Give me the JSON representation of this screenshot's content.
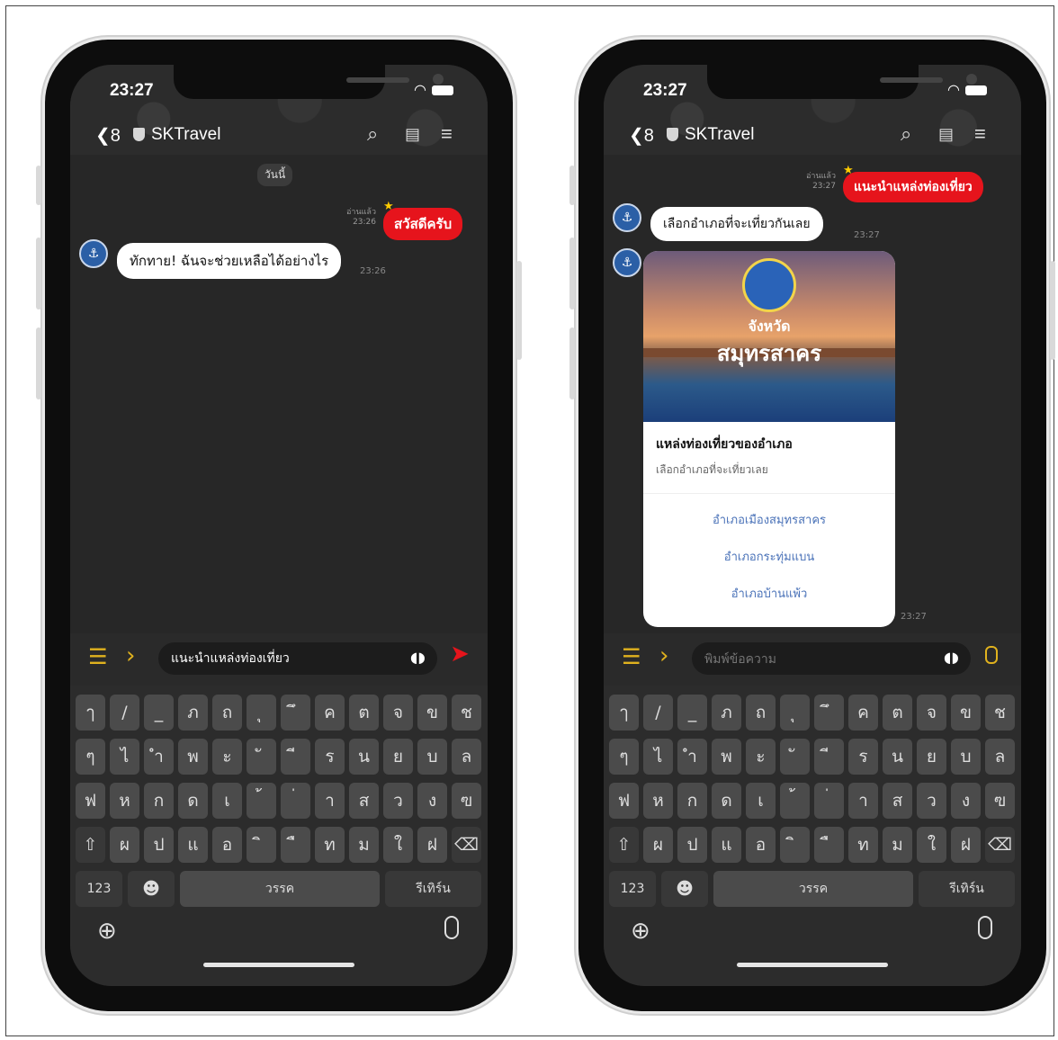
{
  "status_time": "23:27",
  "chat": {
    "back_count": "8",
    "name": "SKTravel"
  },
  "left": {
    "day_label": "วันนี้",
    "read_label": "อ่านแล้ว",
    "out_time": "23:26",
    "out_text": "สวัสดีครับ",
    "in_text": "ทักทาย! ฉันจะช่วยเหลือได้อย่างไร",
    "in_time": "23:26",
    "input_value": "แนะนำแหล่งท่องเที่ยว"
  },
  "right": {
    "read_label": "อ่านแล้ว",
    "out_time": "23:27",
    "out_text": "แนะนำแหล่งท่องเที่ยว",
    "in_text": "เลือกอำเภอที่จะเที่ยวกันเลย",
    "in_time": "23:27",
    "card": {
      "image_line1": "จังหวัด",
      "image_line2": "สมุทรสาคร",
      "title": "แหล่งท่องเที่ยวของอำเภอ",
      "subtitle": "เลือกอำเภอที่จะเที่ยวเลย",
      "options": [
        "อำเภอเมืองสมุทรสาคร",
        "อำเภอกระทุ่มแบน",
        "อำเภอบ้านแพ้ว"
      ],
      "time": "23:27"
    },
    "input_placeholder": "พิมพ์ข้อความ"
  },
  "keyboard": {
    "row1": [
      "ๅ",
      "/",
      "_",
      "ภ",
      "ถ",
      "ุ",
      "ึ",
      "ค",
      "ต",
      "จ",
      "ข",
      "ช"
    ],
    "row2": [
      "ๆ",
      "ไ",
      "ำ",
      "พ",
      "ะ",
      "ั",
      "ี",
      "ร",
      "น",
      "ย",
      "บ",
      "ล"
    ],
    "row3": [
      "ฟ",
      "ห",
      "ก",
      "ด",
      "เ",
      "้",
      "่",
      "า",
      "ส",
      "ว",
      "ง",
      "ฃ"
    ],
    "row4": [
      "ผ",
      "ป",
      "แ",
      "อ",
      "ิ",
      "ื",
      "ท",
      "ม",
      "ใ",
      "ฝ"
    ],
    "shift": "⇧",
    "delete": "⌫",
    "numbers": "123",
    "emoji": "☻",
    "space": "วรรค",
    "return": "รีเทิร์น"
  },
  "colors": {
    "accent": "#e6141c",
    "yellow": "#e0b21e",
    "bg": "#272727"
  }
}
